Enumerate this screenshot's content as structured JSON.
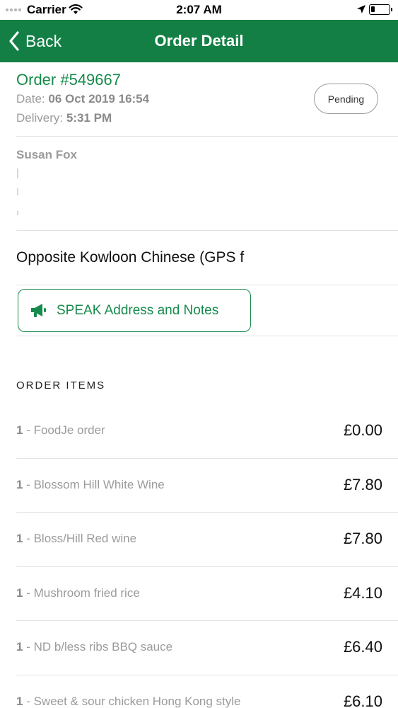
{
  "status_bar": {
    "carrier": "Carrier",
    "time": "2:07 AM"
  },
  "nav": {
    "back_label": "Back",
    "title": "Order Detail"
  },
  "order": {
    "number": "Order #549667",
    "date_label": "Date:",
    "date_value": "06 Oct 2019 16:54",
    "delivery_label": "Delivery:",
    "delivery_value": "5:31 PM",
    "status": "Pending"
  },
  "customer": {
    "name": "Susan Fox"
  },
  "address": {
    "text": "Opposite Kowloon Chinese (GPS f"
  },
  "speak_button": {
    "label": "SPEAK Address and Notes",
    "icon": "megaphone-icon"
  },
  "items_section": {
    "title": "ORDER ITEMS"
  },
  "items": [
    {
      "qty": "1",
      "sep": " - ",
      "name": "FoodJe order",
      "price": "£0.00"
    },
    {
      "qty": "1",
      "sep": " - ",
      "name": "Blossom Hill White Wine",
      "price": "£7.80"
    },
    {
      "qty": "1",
      "sep": " - ",
      "name": "Bloss/Hill Red wine",
      "price": "£7.80"
    },
    {
      "qty": "1",
      "sep": " - ",
      "name": "Mushroom fried rice",
      "price": "£4.10"
    },
    {
      "qty": "1",
      "sep": " - ",
      "name": "ND b/less ribs BBQ sauce",
      "price": "£6.40"
    },
    {
      "qty": "1",
      "sep": " - ",
      "name": "Sweet & sour chicken Hong Kong style",
      "price": "£6.10"
    }
  ],
  "colors": {
    "brand_green": "#137f45",
    "accent_green": "#168a4c",
    "muted_text": "#9b9b9b"
  }
}
